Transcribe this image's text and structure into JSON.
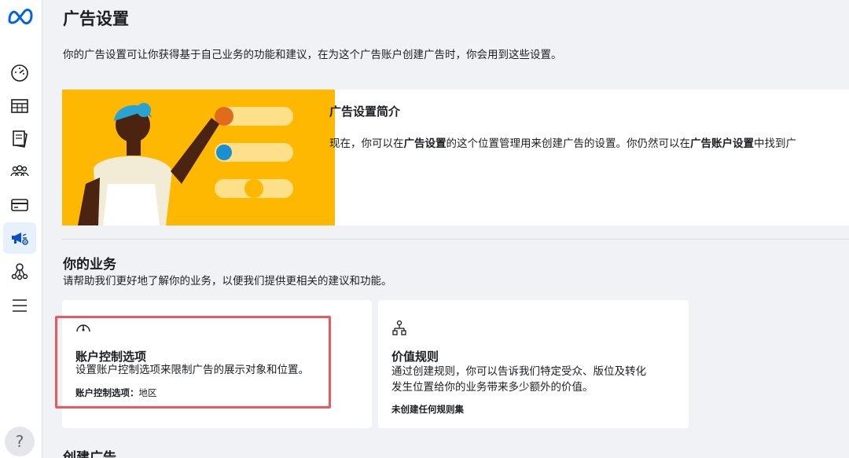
{
  "brand": {
    "logo_icon": "meta-logo-icon",
    "color": "#0064e0"
  },
  "sidebar": {
    "items": [
      {
        "name": "dashboard-gauge-icon",
        "active": false
      },
      {
        "name": "table-grid-icon",
        "active": false
      },
      {
        "name": "pages-icon",
        "active": false
      },
      {
        "name": "audience-people-icon",
        "active": false
      },
      {
        "name": "billing-card-icon",
        "active": false
      },
      {
        "name": "megaphone-settings-icon",
        "active": true
      },
      {
        "name": "events-network-icon",
        "active": false
      },
      {
        "name": "menu-icon",
        "active": false
      }
    ],
    "help_label": "?"
  },
  "page": {
    "title": "广告设置",
    "description": "你的广告设置可让你获得基于自己业务的功能和建议，在为这个广告账户创建广告时，你会用到这些设置。"
  },
  "intro": {
    "title": "广告设置简介",
    "text_prefix": "现在，你可以在",
    "text_bold1": "广告设置",
    "text_middle": "的这个位置管理用来创建广告的设置。你仍然可以在",
    "text_bold2": "广告账户设置",
    "text_suffix": "中找到广"
  },
  "business": {
    "title": "你的业务",
    "description": "请帮助我们更好地了解你的业务，以便我们提供更相关的建议和功能。",
    "cards": [
      {
        "title": "账户控制选项",
        "description": "设置账户控制选项来限制广告的展示对象和位置。",
        "meta_label": "账户控制选项：",
        "meta_value": "地区"
      },
      {
        "title": "价值规则",
        "description_line1": "通过创建规则，你可以告诉我们特定受众、版位及转化",
        "description_line2": "发生位置给你的业务带来多少额外的价值。",
        "meta_label": "未创建任何规则集"
      }
    ]
  },
  "next_section": {
    "title": "创建广告"
  },
  "colors": {
    "illustration_bg": "#ffb800",
    "highlight": "#e85a5e",
    "active_nav": "#e7f0fd"
  }
}
